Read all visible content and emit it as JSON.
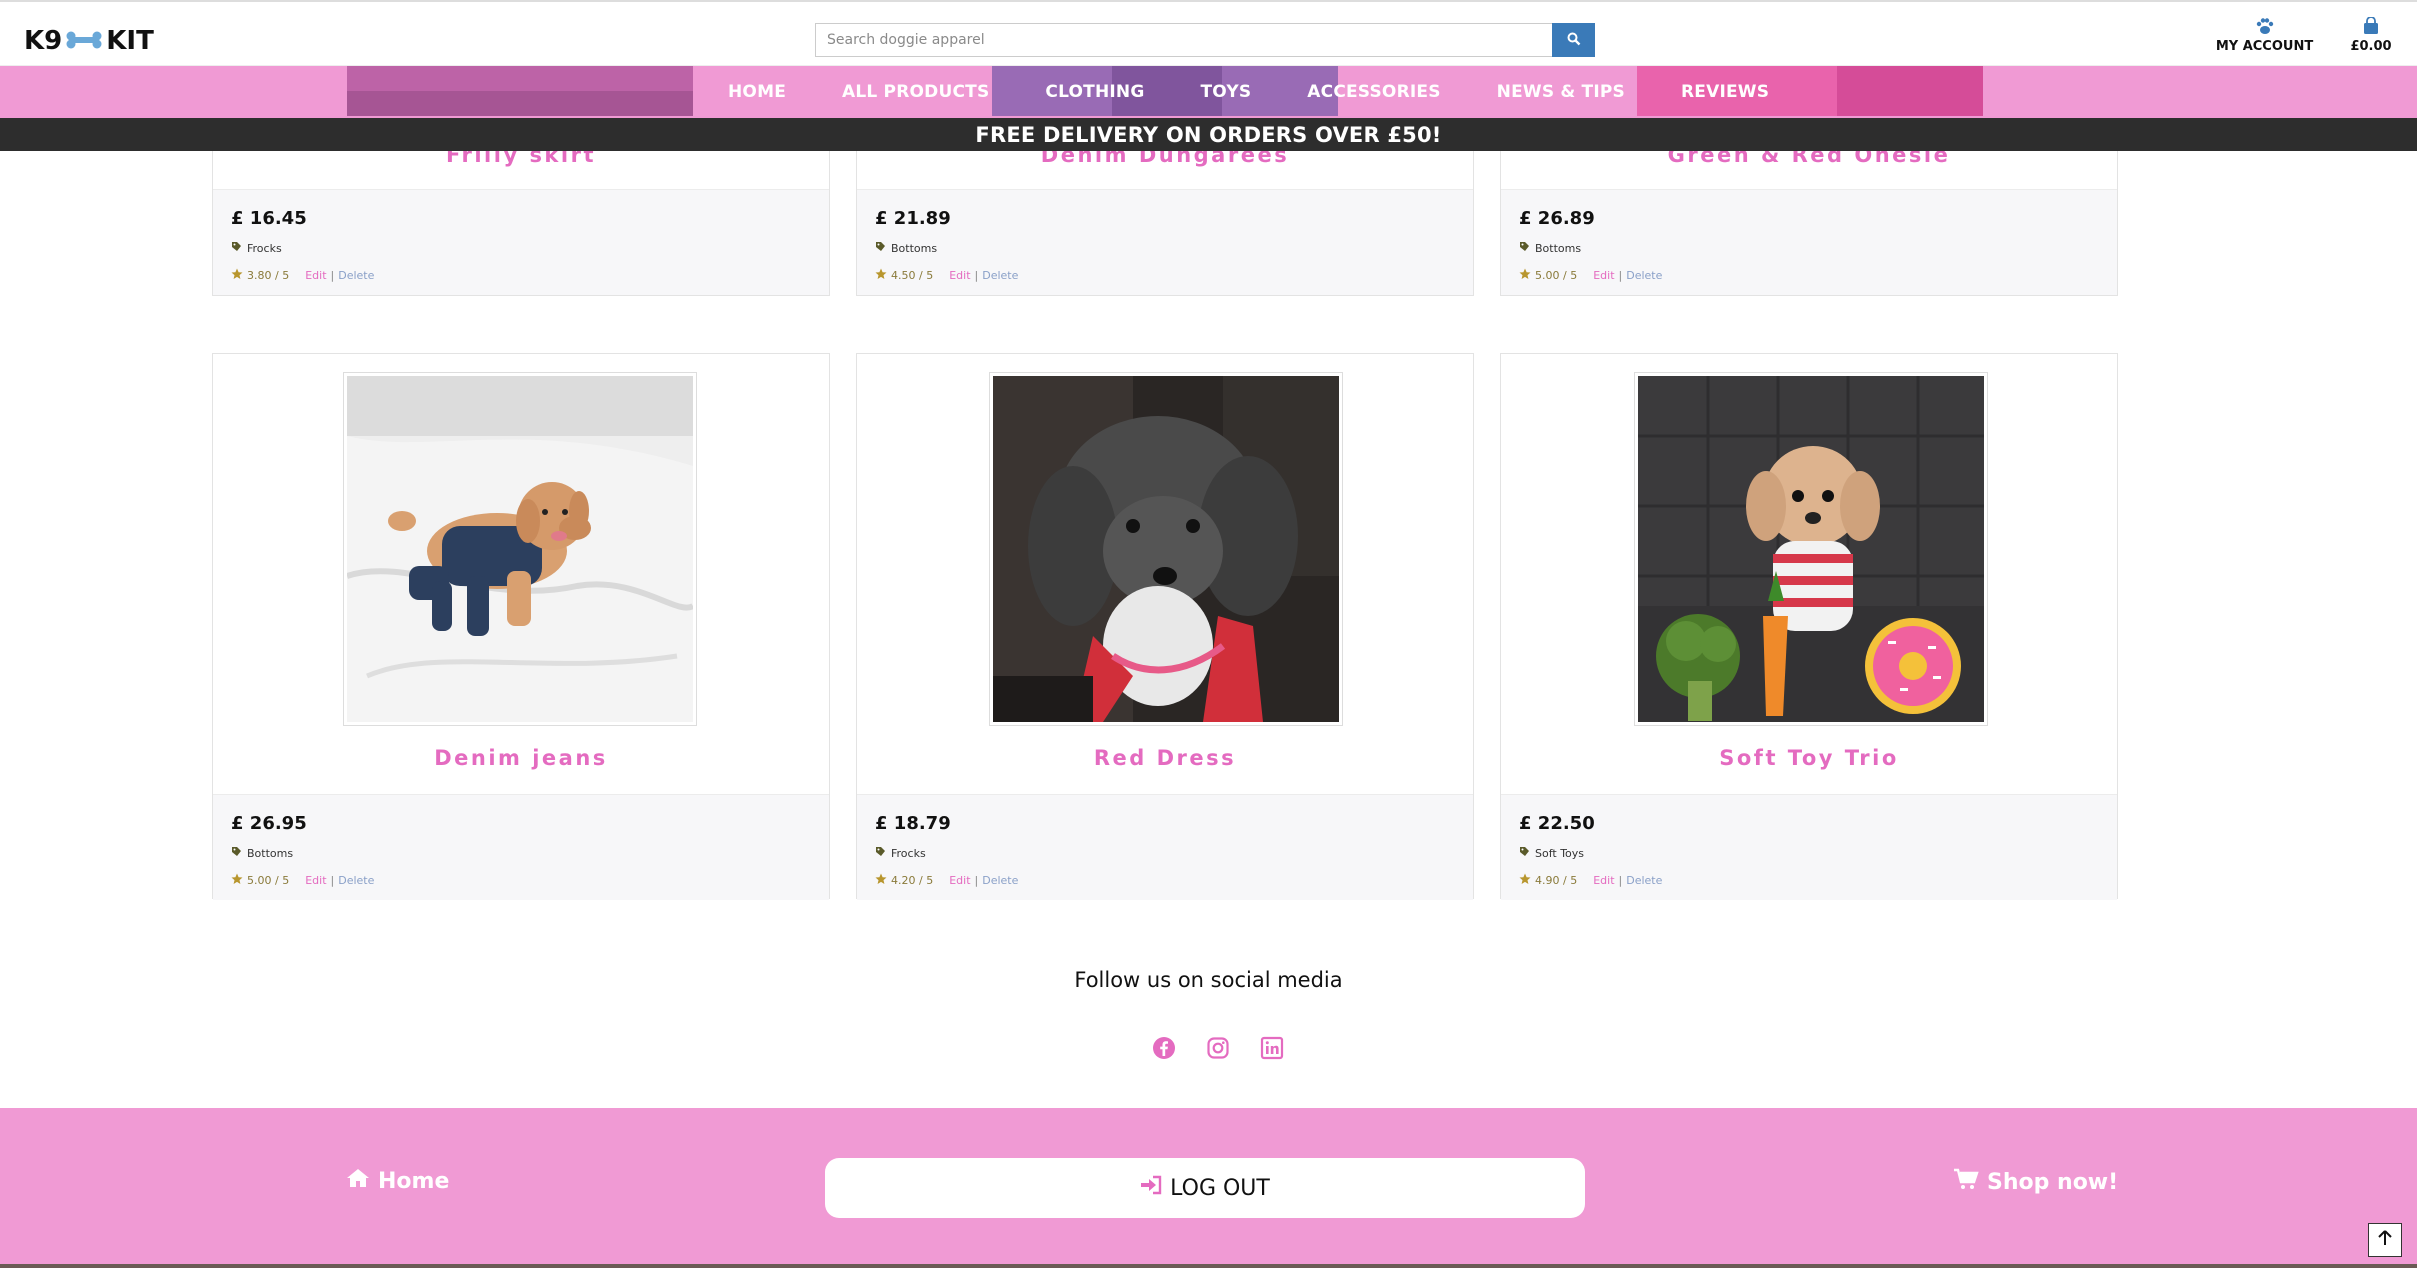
{
  "header": {
    "logo_left": "K9",
    "logo_right": "KIT",
    "search_placeholder": "Search doggie apparel",
    "account_label": "MY ACCOUNT",
    "cart_total": "£0.00"
  },
  "nav": {
    "items": [
      "HOME",
      "ALL PRODUCTS",
      "CLOTHING",
      "TOYS",
      "ACCESSORIES",
      "NEWS & TIPS",
      "REVIEWS"
    ]
  },
  "banner": "FREE DELIVERY ON ORDERS OVER £50!",
  "products_top": [
    {
      "title": "Frilly skirt",
      "price": "£ 16.45",
      "category": "Frocks",
      "rating": "3.80 / 5"
    },
    {
      "title": "Denim Dungarees",
      "price": "£ 21.89",
      "category": "Bottoms",
      "rating": "4.50 / 5"
    },
    {
      "title": "Green & Red Onesie",
      "price": "£ 26.89",
      "category": "Bottoms",
      "rating": "5.00 / 5"
    }
  ],
  "products": [
    {
      "title": "Denim jeans",
      "price": "£ 26.95",
      "category": "Bottoms",
      "rating": "5.00 / 5"
    },
    {
      "title": "Red Dress",
      "price": "£ 18.79",
      "category": "Frocks",
      "rating": "4.20 / 5"
    },
    {
      "title": "Soft Toy Trio",
      "price": "£ 22.50",
      "category": "Soft Toys",
      "rating": "4.90 / 5"
    }
  ],
  "actions": {
    "edit": "Edit",
    "separator": "|",
    "delete": "Delete"
  },
  "social": {
    "title": "Follow us on social media",
    "icons": [
      "facebook-icon",
      "instagram-icon",
      "linkedin-icon"
    ]
  },
  "footer": {
    "home": "Home",
    "logout": "LOG OUT",
    "shop": "Shop now!"
  },
  "colors": {
    "pink": "#f09ad4",
    "title_pink": "#e46bc0",
    "search_blue": "#3a7ab8",
    "banner": "#2d2d2d"
  }
}
